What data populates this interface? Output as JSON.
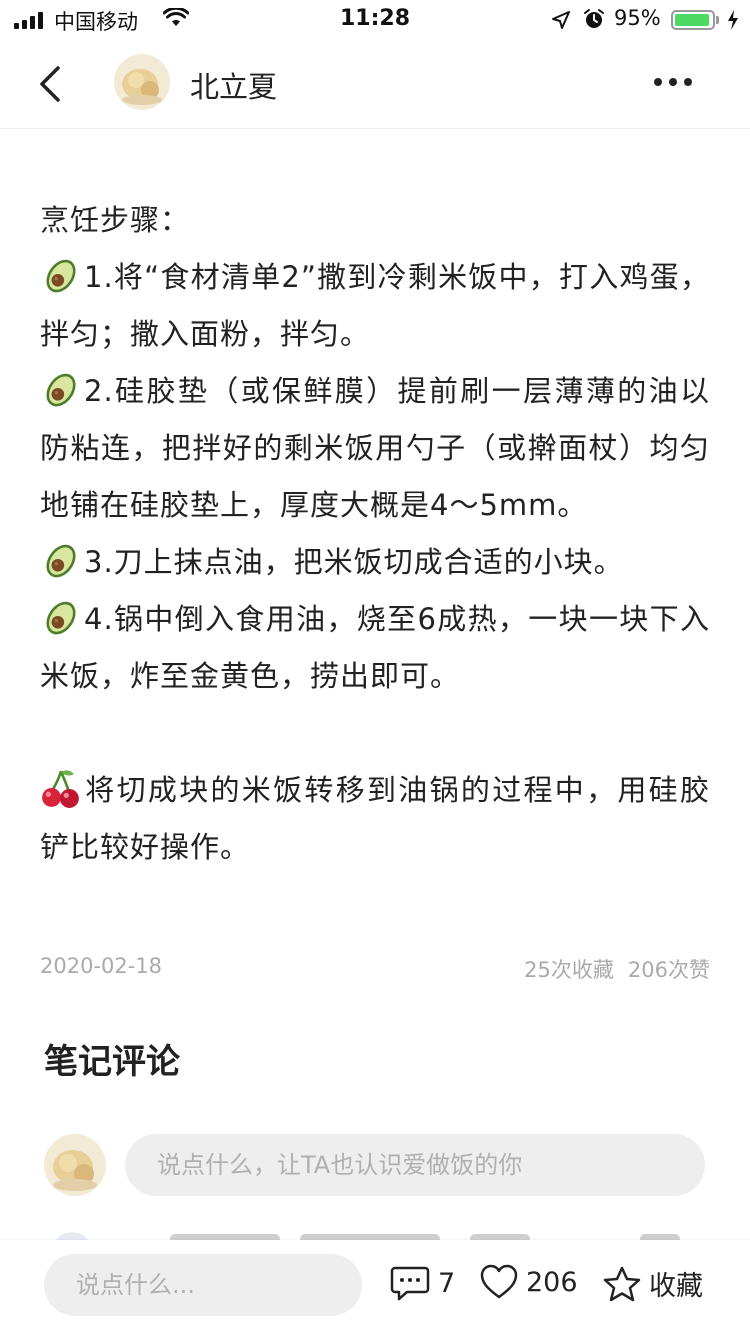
{
  "status_bar": {
    "carrier": "中国移动",
    "time": "11:28",
    "battery_percent": "95%",
    "battery_level": 0.95
  },
  "nav": {
    "author_name": "北立夏"
  },
  "content": {
    "heading": "烹饪步骤：",
    "steps": [
      "1.将“食材清单2”撒到冷剩米饭中，打入鸡蛋，拌匀；撒入面粉，拌匀。",
      "2.硅胶垫（或保鲜膜）提前刷一层薄薄的油以防粘连，把拌好的剩米饭用勺子（或擀面杖）均匀地铺在硅胶垫上，厚度大概是4～5mm。",
      "3.刀上抹点油，把米饭切成合适的小块。",
      "4.锅中倒入食用油，烧至6成热，一块一块下入米饭，炸至金黄色，捞出即可。"
    ],
    "tip": "将切成块的米饭转移到油锅的过程中，用硅胶铲比较好操作。",
    "step_icon": "avocado-emoji",
    "tip_icon": "cherries-emoji"
  },
  "meta": {
    "date": "2020-02-18",
    "favorites": "25次收藏",
    "likes": "206次赞"
  },
  "comments": {
    "title": "笔记评论",
    "input_placeholder": "说点什么，让TA也认识爱做饭的你"
  },
  "bottom_bar": {
    "input_placeholder": "说点什么...",
    "comment_count": "7",
    "like_count": "206",
    "favorite_label": "收藏"
  },
  "colors": {
    "battery_green": "#4cd964",
    "input_bg": "#eeeeee",
    "meta_text": "#aaaaaa"
  }
}
